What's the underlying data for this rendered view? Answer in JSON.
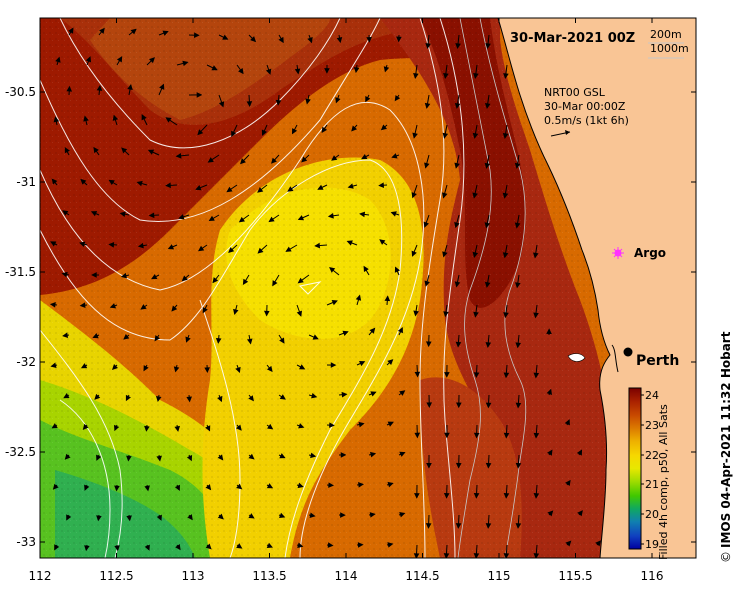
{
  "map": {
    "title": "30-Mar-2021 00Z",
    "depth_legend": [
      "200m",
      "1000m"
    ],
    "current_legend": {
      "lines": [
        "NRT00 GSL",
        "30-Mar 00:00Z",
        "0.5m/s (1kt 6h)"
      ],
      "arrow_icon": "scale-arrow-icon"
    },
    "lon_ticks": [
      "112",
      "112.5",
      "113",
      "113.5",
      "114",
      "114.5",
      "115",
      "115.5",
      "116"
    ],
    "lat_ticks": [
      "-30.5",
      "-31",
      "-31.5",
      "-32",
      "-32.5",
      "-33"
    ],
    "places": [
      {
        "label": "Argo",
        "icon": "argo-float-icon",
        "color": "#ff33ff"
      },
      {
        "label": "Perth",
        "icon": "city-dot-icon",
        "color": "#000000"
      }
    ]
  },
  "colorbar": {
    "ticks": [
      "24",
      "23",
      "22",
      "21",
      "20",
      "19"
    ],
    "label": "Filled 4h comp, p50, All Sats",
    "colors": [
      "#7a0000",
      "#a82000",
      "#c84a00",
      "#dc7a00",
      "#eeb000",
      "#f6d800",
      "#e8e800",
      "#a0dc00",
      "#40c800",
      "#10a860",
      "#1080b0",
      "#1040c0",
      "#0000a0"
    ]
  },
  "credit": "IMOS 04-Apr-2021 11:32 Hobart",
  "copyright_symbol": "©",
  "colors": {
    "land": "#f9c595",
    "warm": "#9e1a00",
    "mid": "#d86a00",
    "yellow": "#f0d000",
    "cool": "#50c020"
  }
}
